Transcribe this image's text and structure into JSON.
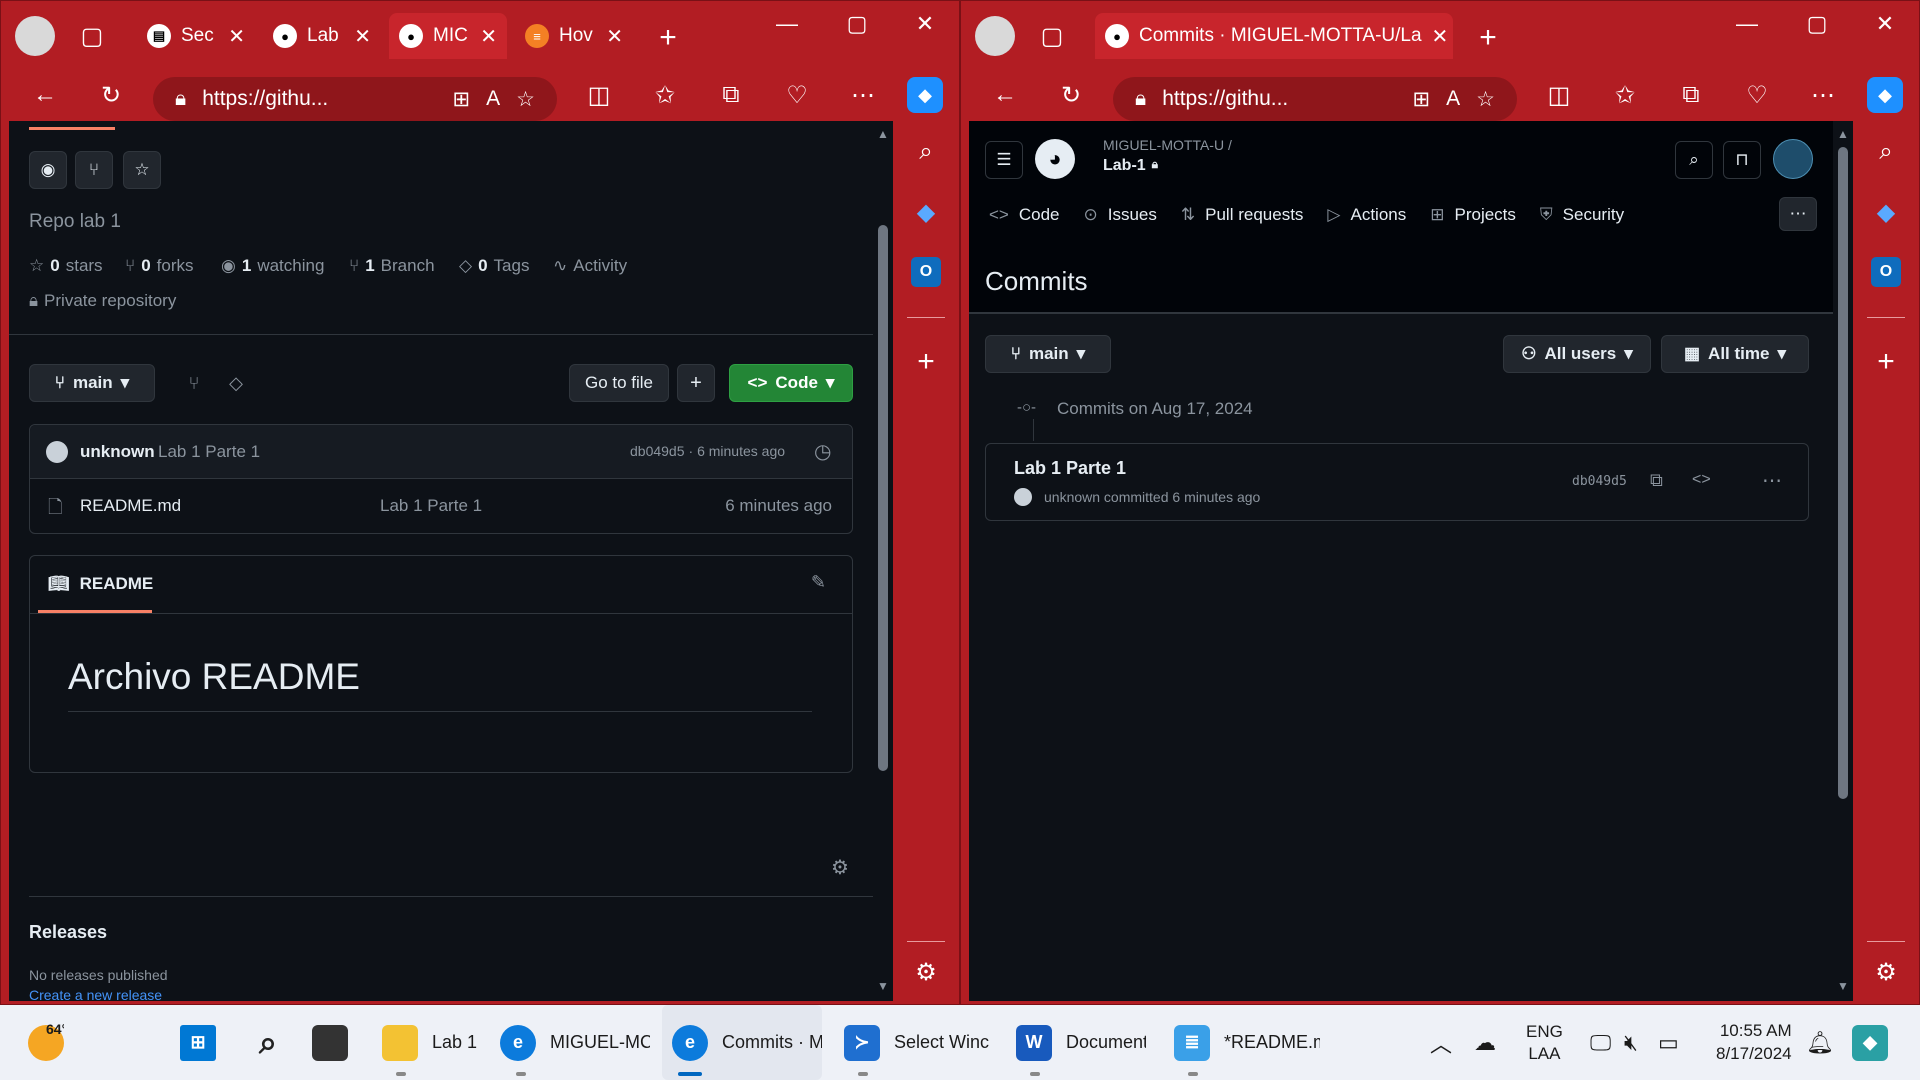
{
  "left": {
    "tabs": [
      {
        "label": "Sec",
        "icon": "repo-tab-icon"
      },
      {
        "label": "Lab",
        "icon": "github-icon"
      },
      {
        "label": "MIC",
        "icon": "github-icon",
        "active": true
      },
      {
        "label": "Hov",
        "icon": "stackoverflow-icon"
      }
    ],
    "url": "https://githu...",
    "repo": {
      "description": "Repo lab 1",
      "stars": "0",
      "stars_label": "stars",
      "forks": "0",
      "forks_label": "forks",
      "watching": "1",
      "watching_label": "watching",
      "branches": "1",
      "branches_label": "Branch",
      "tags": "0",
      "tags_label": "Tags",
      "activity": "Activity",
      "visibility": "Private repository"
    },
    "branch": "main",
    "go_to_file": "Go to file",
    "add": "+",
    "code_btn": "Code",
    "latest_commit": {
      "author": "unknown",
      "message": "Lab 1 Parte 1",
      "sha": "db049d5",
      "time": "· 6 minutes ago"
    },
    "files": [
      {
        "name": "README.md",
        "message": "Lab 1 Parte 1",
        "time": "6 minutes ago"
      }
    ],
    "readme_tab": "README",
    "readme_heading": "Archivo README",
    "releases_title": "Releases",
    "releases_none": "No releases published",
    "releases_create": "Create a new release"
  },
  "right": {
    "tab_title": "Commits · MIGUEL-MOTTA-U/La",
    "url": "https://githu...",
    "owner": "MIGUEL-MOTTA-U /",
    "repo": "Lab-1",
    "nav": [
      "Code",
      "Issues",
      "Pull requests",
      "Actions",
      "Projects",
      "Security"
    ],
    "page_title": "Commits",
    "branch": "main",
    "users_filter": "All users",
    "time_filter": "All time",
    "group_header": "Commits on Aug 17, 2024",
    "commits": [
      {
        "title": "Lab 1 Parte 1",
        "meta": "unknown committed 6 minutes ago",
        "sha": "db049d5"
      }
    ]
  },
  "taskbar": {
    "weather": "64°",
    "items": [
      {
        "label": "Lab 1"
      },
      {
        "label": "MIGUEL-MC"
      },
      {
        "label": "Commits · M"
      },
      {
        "label": "Select Winc"
      },
      {
        "label": "Document"
      },
      {
        "label": "*README.m"
      }
    ],
    "lang1": "ENG",
    "lang2": "LAA",
    "time": "10:55 AM",
    "date": "8/17/2024"
  },
  "colors": {
    "frame": "#b21d23",
    "page": "#0d1117",
    "code_btn": "#238636",
    "accent": "#f78166"
  }
}
